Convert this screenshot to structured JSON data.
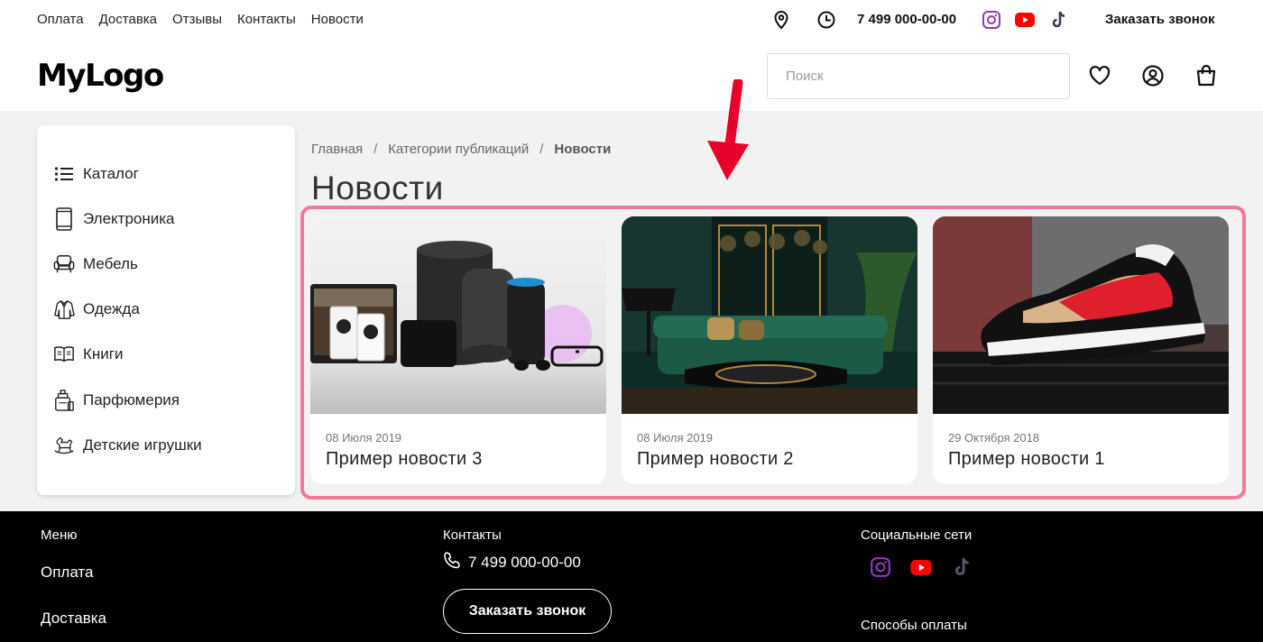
{
  "topnav": [
    "Оплата",
    "Доставка",
    "Отзывы",
    "Контакты",
    "Новости"
  ],
  "phone": "7 499 000-00-00",
  "callback_label": "Заказать звонок",
  "logo": "MyLogo",
  "search": {
    "placeholder": "Поиск"
  },
  "sidebar": {
    "items": [
      {
        "label": "Каталог",
        "icon": "list-icon"
      },
      {
        "label": "Электроника",
        "icon": "tablet-icon"
      },
      {
        "label": "Мебель",
        "icon": "armchair-icon"
      },
      {
        "label": "Одежда",
        "icon": "jacket-icon"
      },
      {
        "label": "Книги",
        "icon": "book-icon"
      },
      {
        "label": "Парфюмерия",
        "icon": "perfume-icon"
      },
      {
        "label": "Детские игрушки",
        "icon": "rocking-horse-icon"
      }
    ]
  },
  "breadcrumb": [
    "Главная",
    "/",
    "Категории публикаций",
    "/",
    "Новости"
  ],
  "page_title": "Новости",
  "news": [
    {
      "date": "08 Июля 2019",
      "title": "Пример новости 3",
      "image": "electronics-devices-photo"
    },
    {
      "date": "08 Июля 2019",
      "title": "Пример новости 2",
      "image": "green-living-room-photo"
    },
    {
      "date": "29 Октября 2018",
      "title": "Пример новости 1",
      "image": "sneaker-photo"
    }
  ],
  "footer": {
    "menu_heading": "Меню",
    "menu_links": [
      "Оплата",
      "Доставка"
    ],
    "contacts_heading": "Контакты",
    "phone": "7 499 000-00-00",
    "callback_label": "Заказать звонок",
    "social_heading": "Социальные сети",
    "payment_heading": "Способы оплаты"
  },
  "colors": {
    "instagram": "#8a3ab9",
    "youtube": "#ff0000",
    "tiktok": "#3b3b4f",
    "highlight": "#ef7b98",
    "arrow": "#e8002a"
  }
}
